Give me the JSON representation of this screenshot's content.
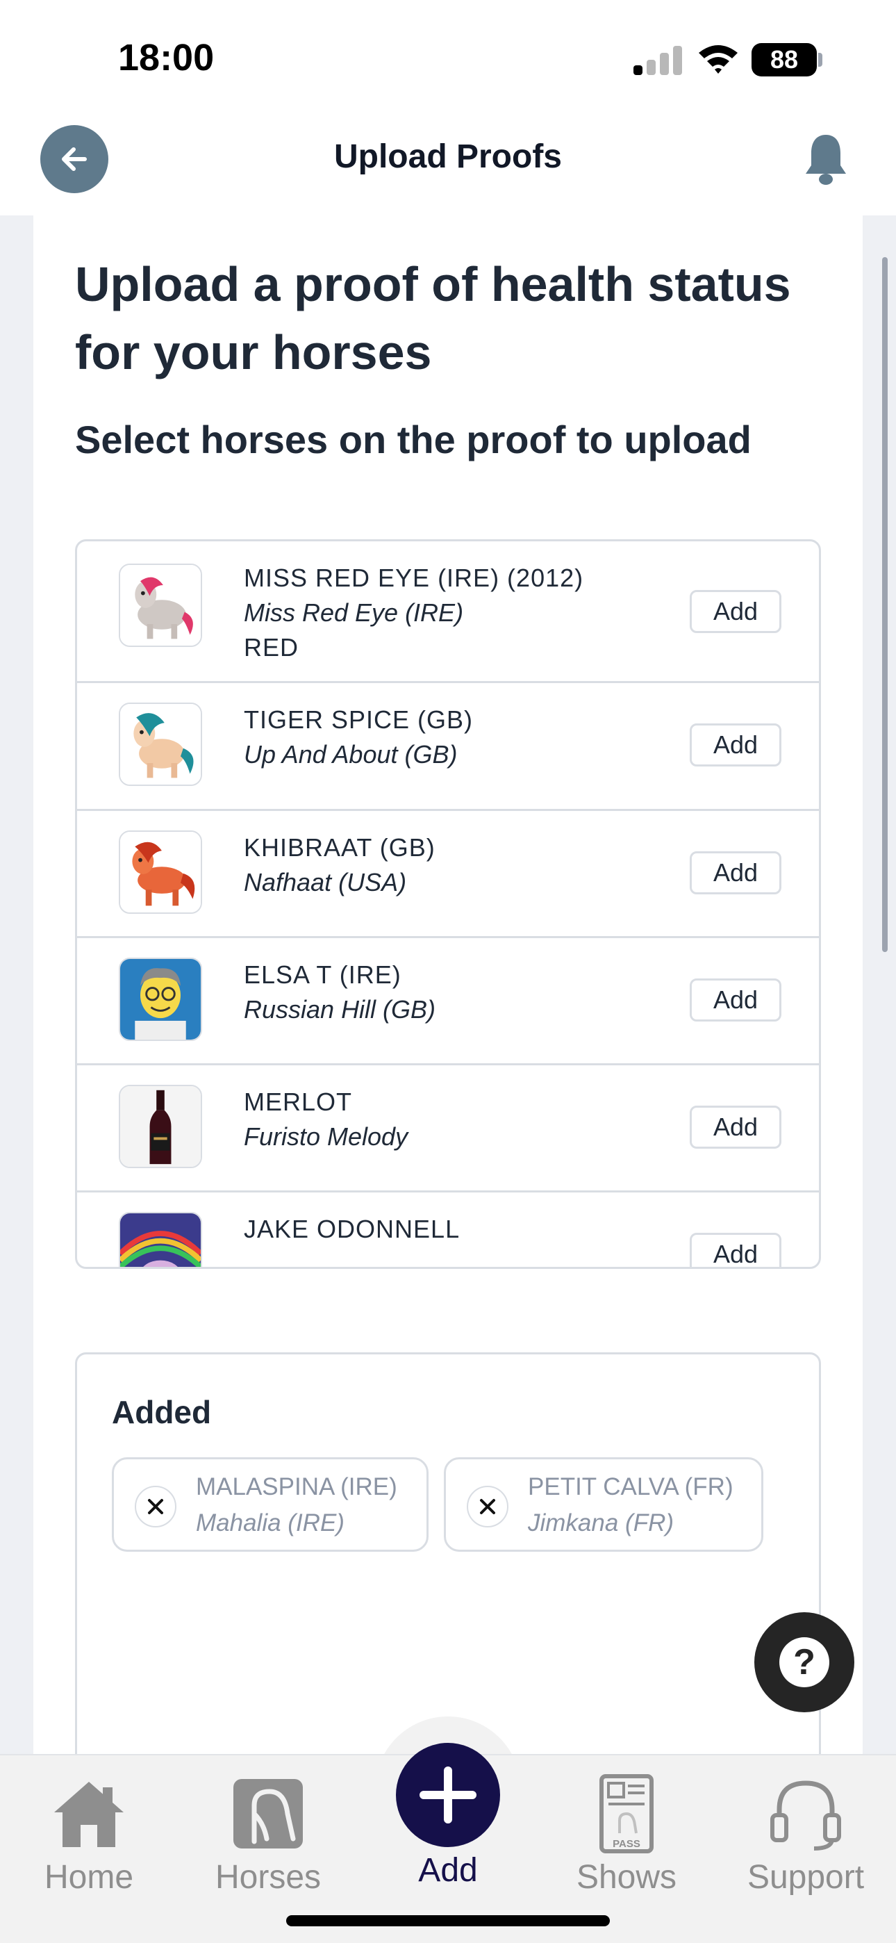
{
  "status_bar": {
    "time": "18:00",
    "battery": "88"
  },
  "header": {
    "title": "Upload Proofs"
  },
  "heading": "Upload a proof of health status for your horses",
  "subheading": "Select horses on the proof to upload",
  "horses": [
    {
      "name": "MISS RED EYE (IRE) (2012)",
      "sire": "Miss Red Eye (IRE)",
      "extra": "RED",
      "add_label": "Add",
      "avatar_icon": "cartoon-pony-red-mane"
    },
    {
      "name": "TIGER SPICE (GB)",
      "sire": "Up And About (GB)",
      "add_label": "Add",
      "avatar_icon": "cartoon-pony-teal-mane"
    },
    {
      "name": "KHIBRAAT (GB)",
      "sire": "Nafhaat (USA)",
      "add_label": "Add",
      "avatar_icon": "cartoon-pony-orange"
    },
    {
      "name": "ELSA T (IRE)",
      "sire": "Russian Hill (GB)",
      "add_label": "Add",
      "avatar_icon": "cartoon-man-portrait"
    },
    {
      "name": "MERLOT",
      "sire": "Furisto Melody",
      "add_label": "Add",
      "avatar_icon": "wine-bottle"
    },
    {
      "name": "JAKE ODONNELL",
      "add_label": "Add",
      "avatar_icon": "rainbow-unicorn"
    }
  ],
  "added": {
    "title": "Added",
    "items": [
      {
        "name": "MALASPINA (IRE)",
        "sire": "Mahalia (IRE)"
      },
      {
        "name": "PETIT CALVA (FR)",
        "sire": "Jimkana (FR)"
      }
    ]
  },
  "help": {
    "label": "?"
  },
  "tabs": [
    {
      "label": "Home",
      "icon": "house-icon"
    },
    {
      "label": "Horses",
      "icon": "horse-icon"
    },
    {
      "label": "Add",
      "icon": "plus-icon",
      "active": true
    },
    {
      "label": "Shows",
      "icon": "pass-icon",
      "icon_text": "PASS"
    },
    {
      "label": "Support",
      "icon": "headset-icon"
    }
  ],
  "colors": {
    "accent": "#15104a",
    "back_button": "#5f7a8c",
    "bell": "#5f7a8c",
    "tab_inactive": "#8e8e8e"
  }
}
